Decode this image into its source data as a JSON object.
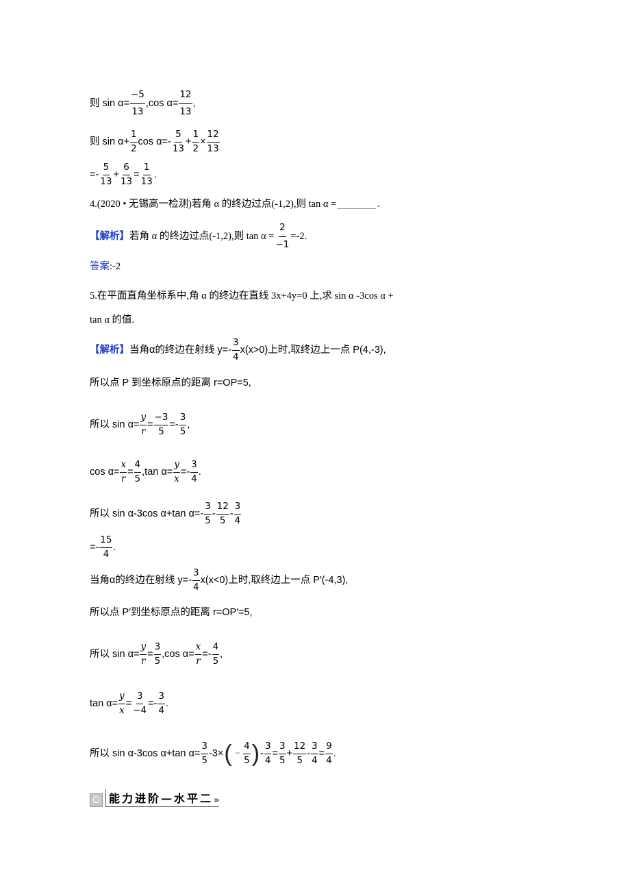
{
  "prev_solution": {
    "line1": {
      "prefix": "则 sin  α=",
      "f1": {
        "num": "−5",
        "den": "13"
      },
      "mid": ",cos  α=",
      "f2": {
        "num": "12",
        "den": "13"
      },
      "suffix": ","
    },
    "line2": {
      "prefix": "则 sin  α+",
      "f1": {
        "num": "1",
        "den": "2"
      },
      "mid": "cos  α=-",
      "f2": {
        "num": "5",
        "den": "13"
      },
      "op1": "+",
      "f3": {
        "num": "1",
        "den": "2"
      },
      "op2": "×",
      "f4": {
        "num": "12",
        "den": "13"
      }
    },
    "line3": {
      "prefix": "=-",
      "f1": {
        "num": "5",
        "den": "13"
      },
      "op1": "+",
      "f2": {
        "num": "6",
        "den": "13"
      },
      "op2": "=",
      "f3": {
        "num": "1",
        "den": "13"
      },
      "suffix": "."
    }
  },
  "q4": {
    "question": {
      "text": "4.(2020 • 无锡高一检测)若角 α 的终边过点(-1,2),则 tan  α =",
      "suffix": "."
    },
    "analysis": {
      "label": "【解析】",
      "text": "若角 α 的终边过点(-1,2),则 tan  α =",
      "f1": {
        "num": "2",
        "den": "−1"
      },
      "suffix": "=-2."
    },
    "answer": {
      "label": "答案",
      "value": ":-2"
    }
  },
  "q5": {
    "question_line1": "5.在平面直角坐标系中,角 α 的终边在直线 3x+4y=0 上,求 sin  α -3cos  α +",
    "question_line2": "tan  α 的值.",
    "analysis_label": "【解析】",
    "case1": {
      "l1": {
        "text": "当角α的终边在射线 y=-",
        "f1": {
          "num": "3",
          "den": "4"
        },
        "suffix": "x(x>0)上时,取终边上一点 P(4,-3),"
      },
      "l2": "所以点 P 到坐标原点的距离 r=OP=5,",
      "l3": {
        "prefix": "所以 sin  α=",
        "f1": {
          "num": "y",
          "den": "r"
        },
        "op1": "=",
        "f2": {
          "num": "−3",
          "den": "5"
        },
        "op2": "=-",
        "f3": {
          "num": "3",
          "den": "5"
        },
        "suffix": ","
      },
      "l4": {
        "prefix": "cos  α=",
        "f1": {
          "num": "x",
          "den": "r"
        },
        "op1": "=",
        "f2": {
          "num": "4",
          "den": "5"
        },
        "mid": ",tan  α=",
        "f3": {
          "num": "y",
          "den": "x"
        },
        "op2": "=-",
        "f4": {
          "num": "3",
          "den": "4"
        },
        "suffix": "."
      },
      "l5": {
        "prefix": "所以 sin  α-3cos  α+tan  α=-",
        "f1": {
          "num": "3",
          "den": "5"
        },
        "op1": "-",
        "f2": {
          "num": "12",
          "den": "5"
        },
        "op2": "-",
        "f3": {
          "num": "3",
          "den": "4"
        }
      },
      "l6": {
        "prefix": "=-",
        "f1": {
          "num": "15",
          "den": "4"
        },
        "suffix": "."
      }
    },
    "case2": {
      "l1": {
        "text": "当角α的终边在射线 y=-",
        "f1": {
          "num": "3",
          "den": "4"
        },
        "suffix": "x(x<0)上时,取终边上一点 P′(-4,3),"
      },
      "l2": "所以点 P′到坐标原点的距离 r=OP′=5,",
      "l3": {
        "prefix": "所以 sin  α=",
        "f1": {
          "num": "y",
          "den": "r"
        },
        "op1": "=",
        "f2": {
          "num": "3",
          "den": "5"
        },
        "mid": ",cos  α=",
        "f3": {
          "num": "x",
          "den": "r"
        },
        "op2": "=-",
        "f4": {
          "num": "4",
          "den": "5"
        },
        "suffix": ","
      },
      "l4": {
        "prefix": "tan  α=",
        "f1": {
          "num": "y",
          "den": "x"
        },
        "op1": "=",
        "f2": {
          "num": "3",
          "den": "−4"
        },
        "op2": "=-",
        "f3": {
          "num": "3",
          "den": "4"
        },
        "suffix": "."
      },
      "l5": {
        "prefix": "所以 sin  α-3cos  α+tan  α=",
        "f1": {
          "num": "3",
          "den": "5"
        },
        "op1": "-3×",
        "paren_open": "(",
        "neg": "−",
        "f2": {
          "num": "4",
          "den": "5"
        },
        "paren_close": ")",
        "op2": "-",
        "f3": {
          "num": "3",
          "den": "4"
        },
        "op3": "=",
        "f4": {
          "num": "3",
          "den": "5"
        },
        "op4": "+",
        "f5": {
          "num": "12",
          "den": "5"
        },
        "op5": "-",
        "f6": {
          "num": "3",
          "den": "4"
        },
        "op6": "=",
        "f7": {
          "num": "9",
          "den": "4"
        },
        "suffix": "."
      }
    }
  },
  "section": {
    "icon": "lightbulb-icon",
    "title": "能力进阶—水平二",
    "chevron": "»"
  },
  "colors": {
    "accent_blue": "#1f3bd6",
    "text": "#000000"
  }
}
